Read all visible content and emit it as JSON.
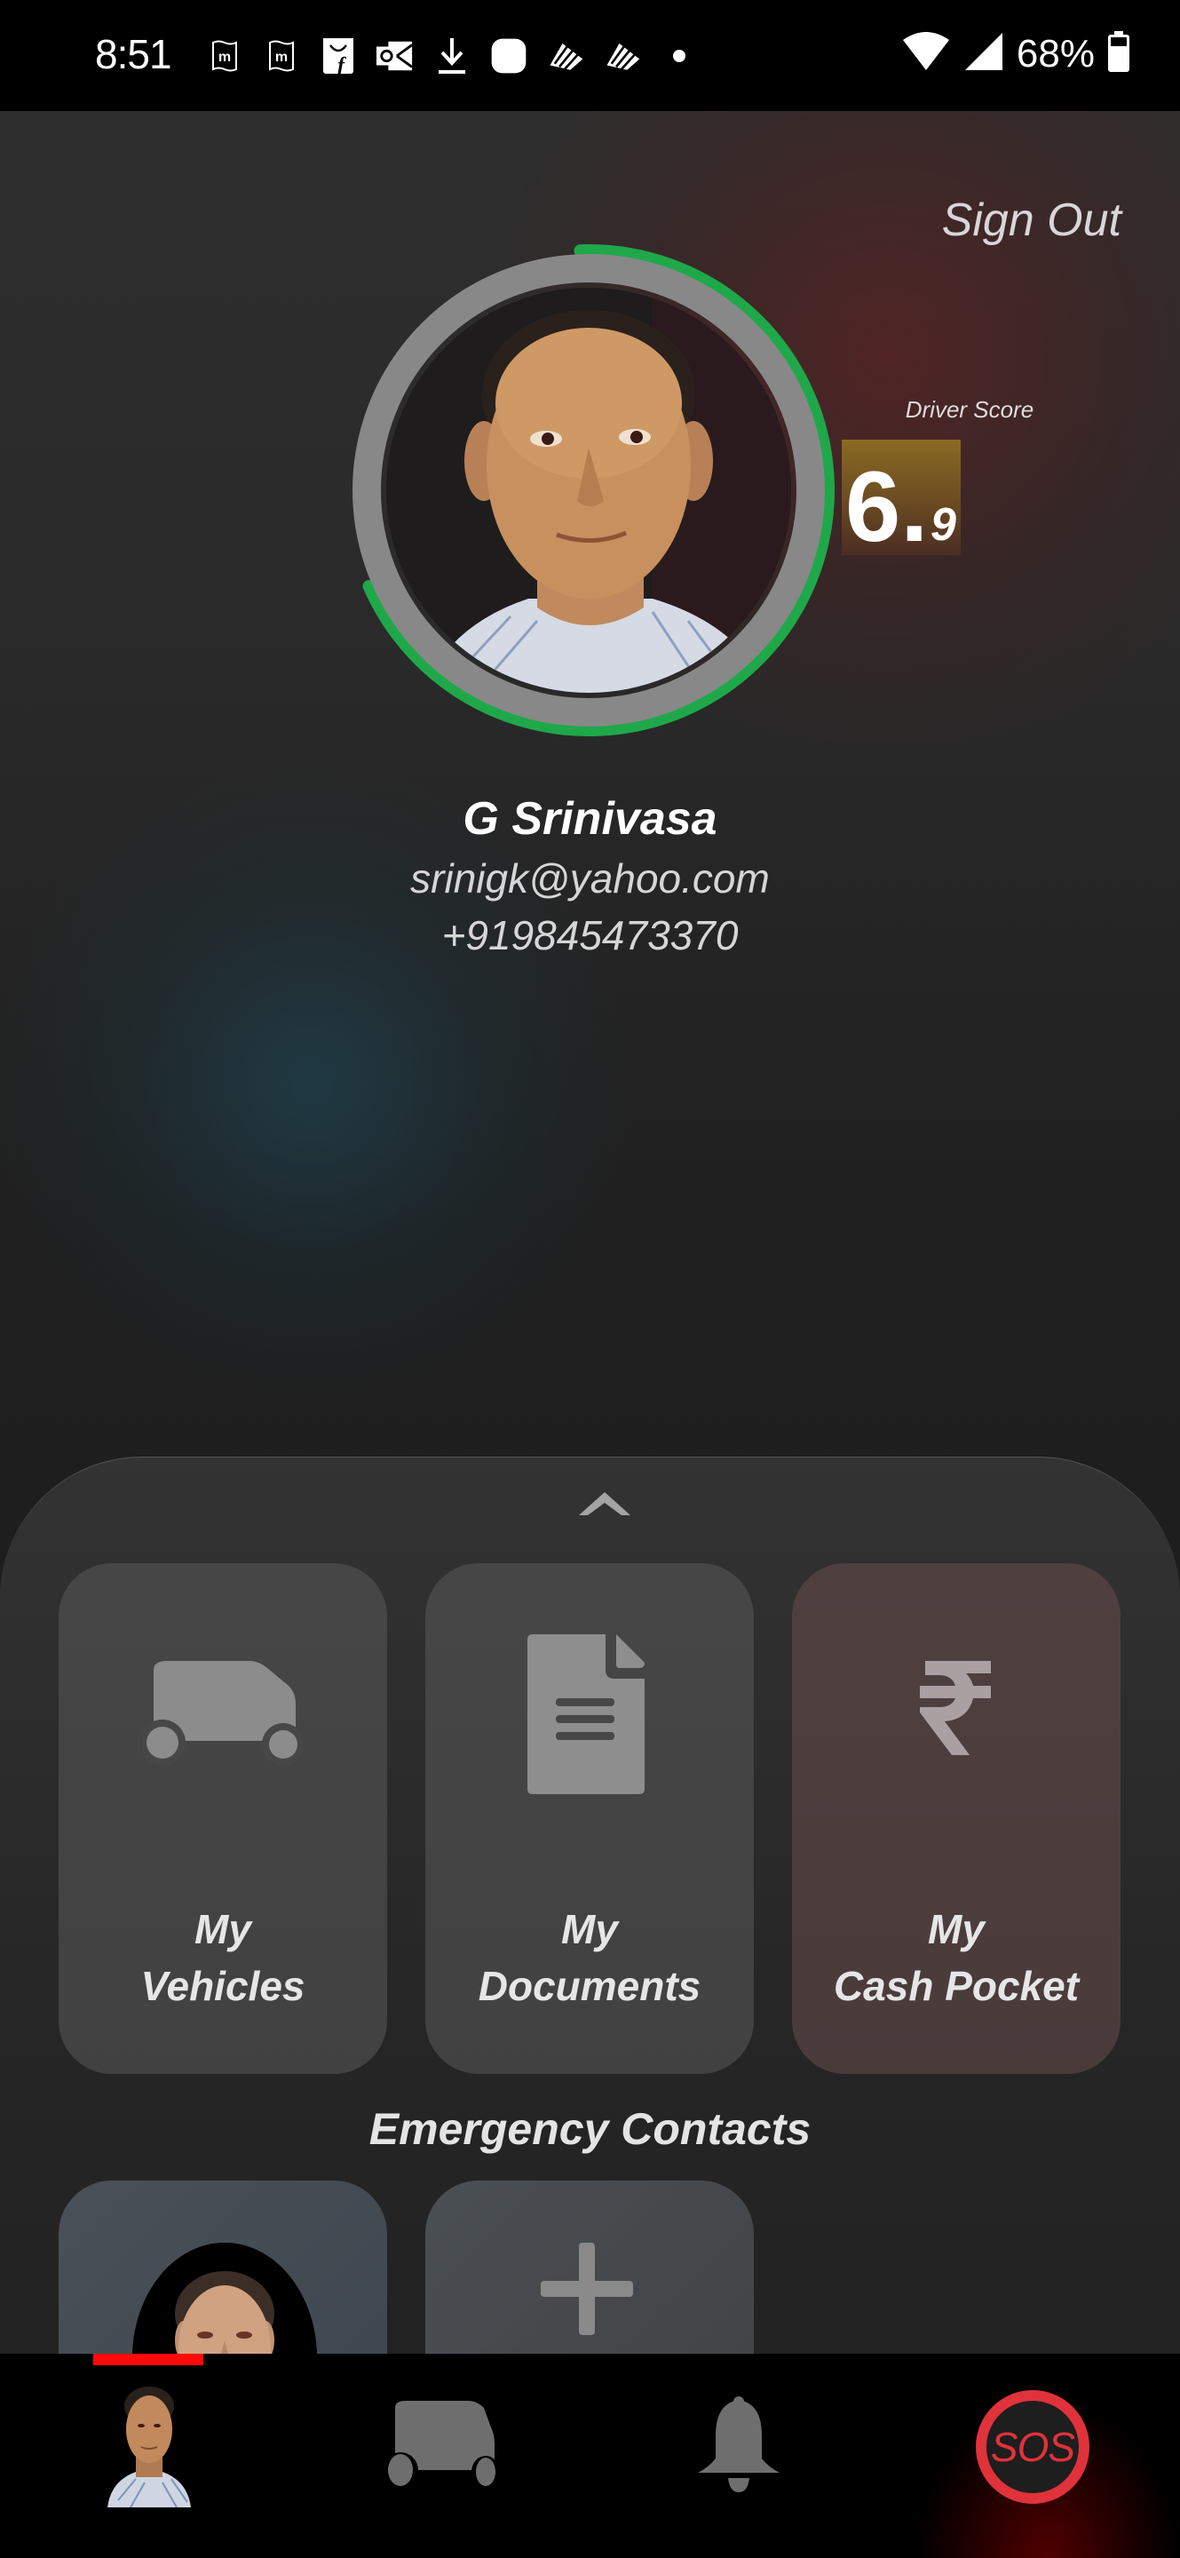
{
  "status_bar": {
    "time": "8:51",
    "notification_icons": [
      "myntra-icon",
      "myntra-icon",
      "flipkart-icon",
      "outlook-icon",
      "download-icon",
      "app-icon",
      "striped-app-icon",
      "striped-app-icon",
      "more-dot-icon"
    ],
    "wifi": "wifi-icon",
    "signal": "cell-signal-icon",
    "battery_percent": "68%"
  },
  "header": {
    "sign_out_label": "Sign Out"
  },
  "profile": {
    "name": "G Srinivasa",
    "email": "srinigk@yahoo.com",
    "phone": "+919845473370",
    "avatar_icon": "profile-photo",
    "score_ring_fraction": 0.69,
    "colors": {
      "ring_track": "#888888",
      "ring_progress": "#1fa84a"
    }
  },
  "driver_score": {
    "label": "Driver Score",
    "integer_part": "6.",
    "decimal_part": "9",
    "value": 6.9
  },
  "panel": {
    "collapse_icon": "chevron-up-icon",
    "cards": [
      {
        "icon": "car-icon",
        "line1": "My",
        "line2": "Vehicles"
      },
      {
        "icon": "document-icon",
        "line1": "My",
        "line2": "Documents"
      },
      {
        "icon": "rupee-icon",
        "line1": "My",
        "line2": "Cash Pocket"
      }
    ],
    "emergency_contacts_title": "Emergency Contacts",
    "emergency_contacts": [
      {
        "type": "contact",
        "icon": "contact-photo"
      },
      {
        "type": "add",
        "icon": "plus-icon"
      }
    ]
  },
  "bottom_nav": {
    "items": [
      {
        "name": "profile",
        "icon": "profile-avatar",
        "active": true
      },
      {
        "name": "vehicle",
        "icon": "car-icon",
        "active": false
      },
      {
        "name": "notifications",
        "icon": "bell-icon",
        "active": false
      },
      {
        "name": "sos",
        "label": "SOS",
        "active": false
      }
    ],
    "accent_color": "#ff0a0a",
    "sos_color": "#e0323a"
  }
}
